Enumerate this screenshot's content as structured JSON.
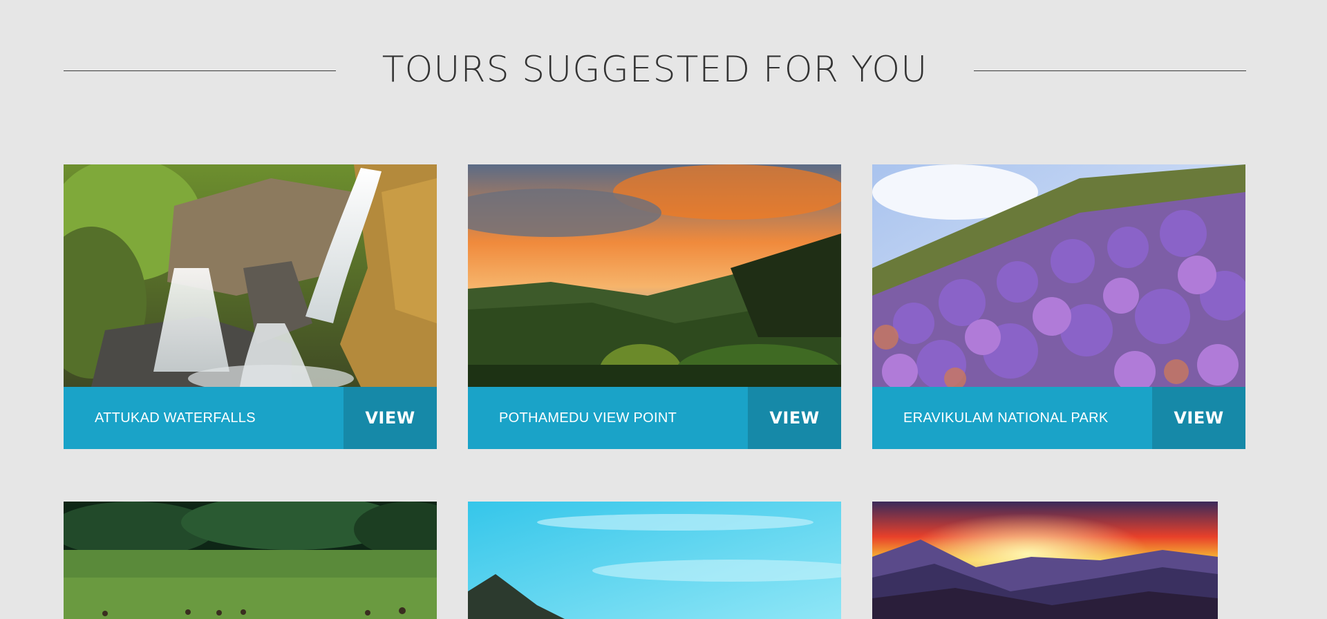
{
  "section": {
    "title": "TOURS SUGGESTED FOR YOU"
  },
  "tours": [
    {
      "name": "ATTUKAD WATERFALLS",
      "view_label": "VIEW",
      "image": "waterfall"
    },
    {
      "name": "POTHAMEDU VIEW POINT",
      "view_label": "VIEW",
      "image": "sunset-valley"
    },
    {
      "name": "ERAVIKULAM NATIONAL PARK",
      "view_label": "VIEW",
      "image": "purple-flowers"
    },
    {
      "image": "grassland-deer"
    },
    {
      "image": "blue-sky-hill"
    },
    {
      "image": "mountain-sunset"
    }
  ],
  "colors": {
    "bar": "#1aa3c8",
    "view_button": "#1689a8",
    "background": "#e6e6e6"
  }
}
